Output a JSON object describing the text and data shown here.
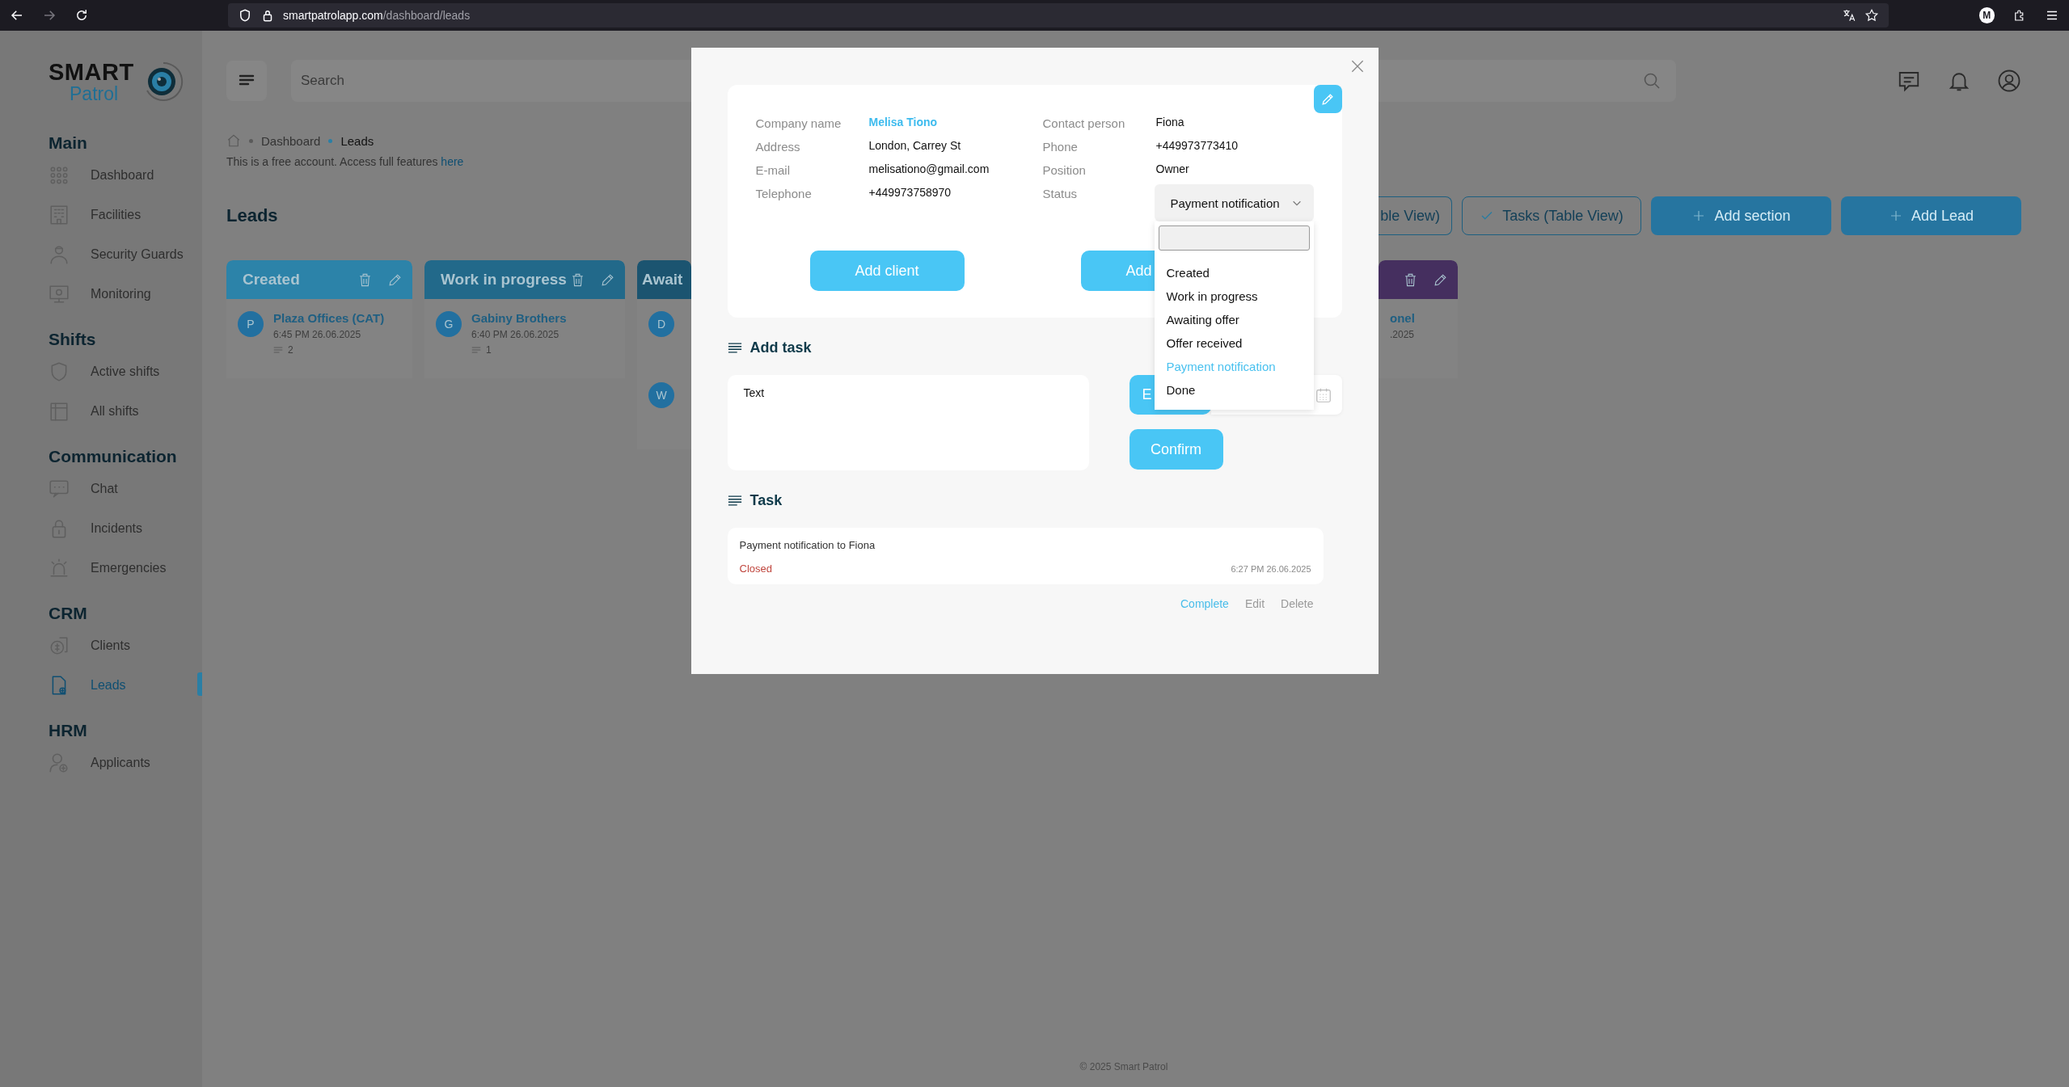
{
  "browser": {
    "url_host": "smartpatrolapp.com",
    "url_path": "/dashboard/leads",
    "profile_initial": "M"
  },
  "sidebar": {
    "logo_top": "SMART",
    "logo_bottom": "Patrol",
    "sections": [
      {
        "title": "Main",
        "items": [
          {
            "label": "Dashboard",
            "selected": false
          },
          {
            "label": "Facilities",
            "selected": false
          },
          {
            "label": "Security Guards",
            "selected": false
          },
          {
            "label": "Monitoring",
            "selected": false
          }
        ]
      },
      {
        "title": "Shifts",
        "items": [
          {
            "label": "Active shifts",
            "selected": false
          },
          {
            "label": "All shifts",
            "selected": false
          }
        ]
      },
      {
        "title": "Communication",
        "items": [
          {
            "label": "Chat",
            "selected": false
          },
          {
            "label": "Incidents",
            "selected": false
          },
          {
            "label": "Emergencies",
            "selected": false
          }
        ]
      },
      {
        "title": "CRM",
        "items": [
          {
            "label": "Clients",
            "selected": false
          },
          {
            "label": "Leads",
            "selected": true
          }
        ]
      },
      {
        "title": "HRM",
        "items": [
          {
            "label": "Applicants",
            "selected": false
          }
        ]
      }
    ]
  },
  "header": {
    "search": {
      "placeholder": "Search"
    }
  },
  "breadcrumb": [
    "Dashboard",
    "Leads"
  ],
  "notice": {
    "text": "This is a free account. Access full features",
    "link": "here"
  },
  "page_title": "Leads",
  "actions": [
    {
      "label": "ble View)",
      "kind": "outline"
    },
    {
      "label": "Tasks (Table View)",
      "kind": "check"
    },
    {
      "label": "Add section",
      "kind": "add"
    },
    {
      "label": "Add Lead",
      "kind": "add"
    }
  ],
  "columns": [
    {
      "title": "Created",
      "color": "#2c83a9",
      "cards": [
        {
          "avatar": "P",
          "name": "Plaza Offices (CAT)",
          "time": "6:45 PM 26.06.2025",
          "comments": "2"
        }
      ]
    },
    {
      "title": "Work in progress",
      "color": "#22698a",
      "cards": [
        {
          "avatar": "G",
          "name": "Gabiny Brothers",
          "time": "6:40 PM 26.06.2025",
          "comments": "1"
        }
      ]
    },
    {
      "title": "Await",
      "color": "#1b5470",
      "cards": [
        {
          "avatar": "D"
        },
        {
          "avatar": "W"
        }
      ]
    },
    {
      "color": "#452f5f",
      "cards": [
        {
          "name": "onel",
          "time": ".2025"
        }
      ]
    }
  ],
  "modal": {
    "details_left": [
      {
        "label": "Company name",
        "value": "Melisa Tiono",
        "highlight": true
      },
      {
        "label": "Address",
        "value": "London, Carrey St",
        "highlight": false
      },
      {
        "label": "E-mail",
        "value": "melisationo@gmail.com",
        "highlight": false
      },
      {
        "label": "Telephone",
        "value": "+449973758970",
        "highlight": false
      }
    ],
    "details_right": [
      {
        "label": "Contact person",
        "value": "Fiona"
      },
      {
        "label": "Phone",
        "value": "+449973773410"
      },
      {
        "label": "Position",
        "value": "Owner"
      }
    ],
    "status": {
      "label": "Status",
      "value": "Payment notification",
      "expanded": true,
      "options": [
        {
          "label": "Created",
          "selected": false
        },
        {
          "label": "Work in progress",
          "selected": false
        },
        {
          "label": "Awaiting offer",
          "selected": false
        },
        {
          "label": "Offer received",
          "selected": false
        },
        {
          "label": "Payment notification",
          "selected": true
        },
        {
          "label": "Done",
          "selected": false
        }
      ]
    },
    "buttons": [
      "Add client",
      "Add"
    ],
    "add_task": {
      "title": "Add task",
      "text": "Text",
      "button": "E",
      "confirm": "Confirm"
    },
    "task": {
      "title": "Task",
      "items": [
        {
          "text": "Payment notification to Fiona",
          "status": "Closed",
          "time": "6:27 PM 26.06.2025"
        }
      ],
      "actions": [
        {
          "label": "Complete",
          "disabled": false
        },
        {
          "label": "Edit",
          "disabled": true
        },
        {
          "label": "Delete",
          "disabled": true
        }
      ]
    }
  },
  "footer": "© 2025 Smart Patrol"
}
